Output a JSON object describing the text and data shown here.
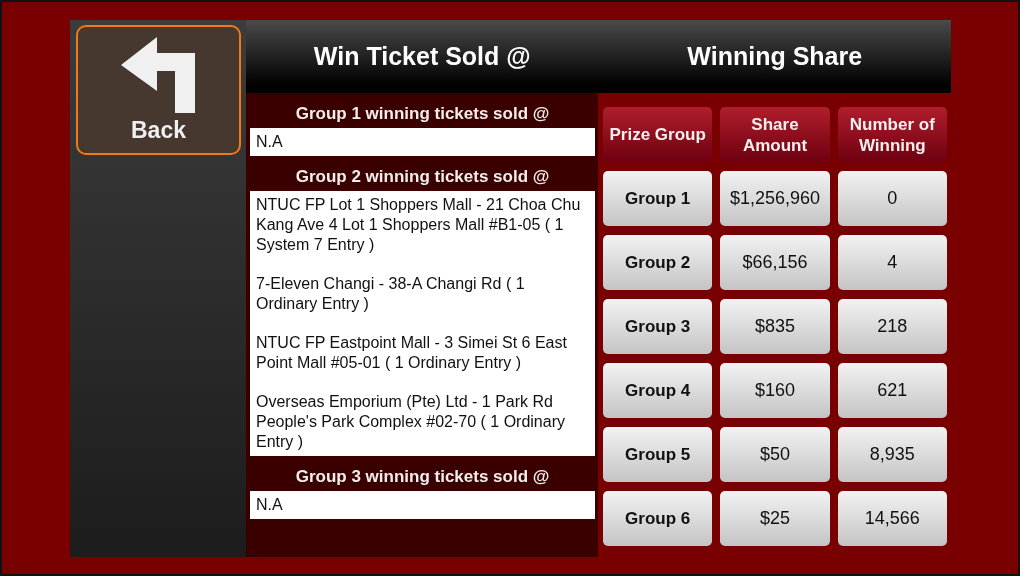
{
  "back_button": {
    "label": "Back"
  },
  "headers": [
    "Win Ticket Sold @",
    "Winning Share"
  ],
  "ticket_groups": [
    {
      "heading": "Group 1 winning tickets sold @",
      "entries": [
        "N.A"
      ]
    },
    {
      "heading": "Group 2 winning tickets sold @",
      "entries": [
        "NTUC FP Lot 1 Shoppers Mall - 21 Choa Chu Kang Ave 4 Lot 1 Shoppers Mall #B1-05 ( 1 System 7 Entry )",
        "7-Eleven Changi - 38-A Changi Rd ( 1 Ordinary Entry )",
        "NTUC FP Eastpoint Mall - 3 Simei St 6 East Point Mall #05-01 ( 1 Ordinary Entry )",
        "Overseas Emporium (Pte) Ltd - 1 Park Rd People's Park Complex #02-70 ( 1 Ordinary Entry )"
      ]
    },
    {
      "heading": "Group 3 winning tickets sold @",
      "entries": [
        "N.A"
      ]
    }
  ],
  "share_table": {
    "columns": [
      "Prize Group",
      "Share Amount",
      "Number of Winning"
    ],
    "rows": [
      [
        "Group 1",
        "$1,256,960",
        "0"
      ],
      [
        "Group 2",
        "$66,156",
        "4"
      ],
      [
        "Group 3",
        "$835",
        "218"
      ],
      [
        "Group 4",
        "$160",
        "621"
      ],
      [
        "Group 5",
        "$50",
        "8,935"
      ],
      [
        "Group 6",
        "$25",
        "14,566"
      ]
    ]
  }
}
